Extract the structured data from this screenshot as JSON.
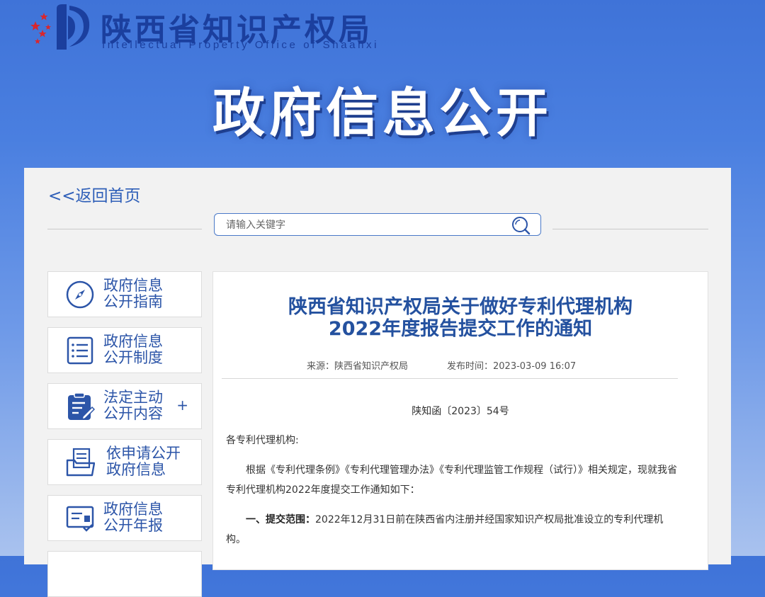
{
  "header": {
    "title_cn": "陕西省知识产权局",
    "title_en": "Intellectual Property Office of Shaanxi",
    "banner": "政府信息公开"
  },
  "nav": {
    "back_label": "<<返回首页"
  },
  "search": {
    "placeholder": "请输入关键字"
  },
  "sidebar": {
    "items": [
      {
        "line1": "政府信息",
        "line2": "公开指南",
        "icon": "compass-icon"
      },
      {
        "line1": "政府信息",
        "line2": "公开制度",
        "icon": "list-document-icon"
      },
      {
        "line1": "法定主动",
        "line2": "公开内容",
        "icon": "clipboard-edit-icon",
        "expand": "+"
      },
      {
        "line1": "依申请公开",
        "line2": "政府信息",
        "icon": "folder-document-icon"
      },
      {
        "line1": "政府信息",
        "line2": "公开年报",
        "icon": "report-screen-icon"
      }
    ]
  },
  "article": {
    "title_line1": "陕西省知识产权局关于做好专利代理机构",
    "title_line2": "2022年度报告提交工作的通知",
    "source_label": "来源：",
    "source": "陕西省知识产权局",
    "time_label": "发布时间：",
    "time": "2023-03-09 16:07",
    "doc_number": "陕知函〔2023〕54号",
    "salutation": "各专利代理机构:",
    "para1": "根据《专利代理条例》《专利代理管理办法》《专利代理监管工作规程（试行）》相关规定，现就我省专利代理机构2022年度提交工作通知如下：",
    "section1_lead": "一、提交范围：",
    "section1_text": "2022年12月31日前在陕西省内注册并经国家知识产权局批准设立的专利代理机构。"
  },
  "colors": {
    "brand_blue": "#1b3f9e",
    "link_blue": "#2c55a8",
    "title_blue": "#24519f",
    "star_red": "#d9262c"
  }
}
